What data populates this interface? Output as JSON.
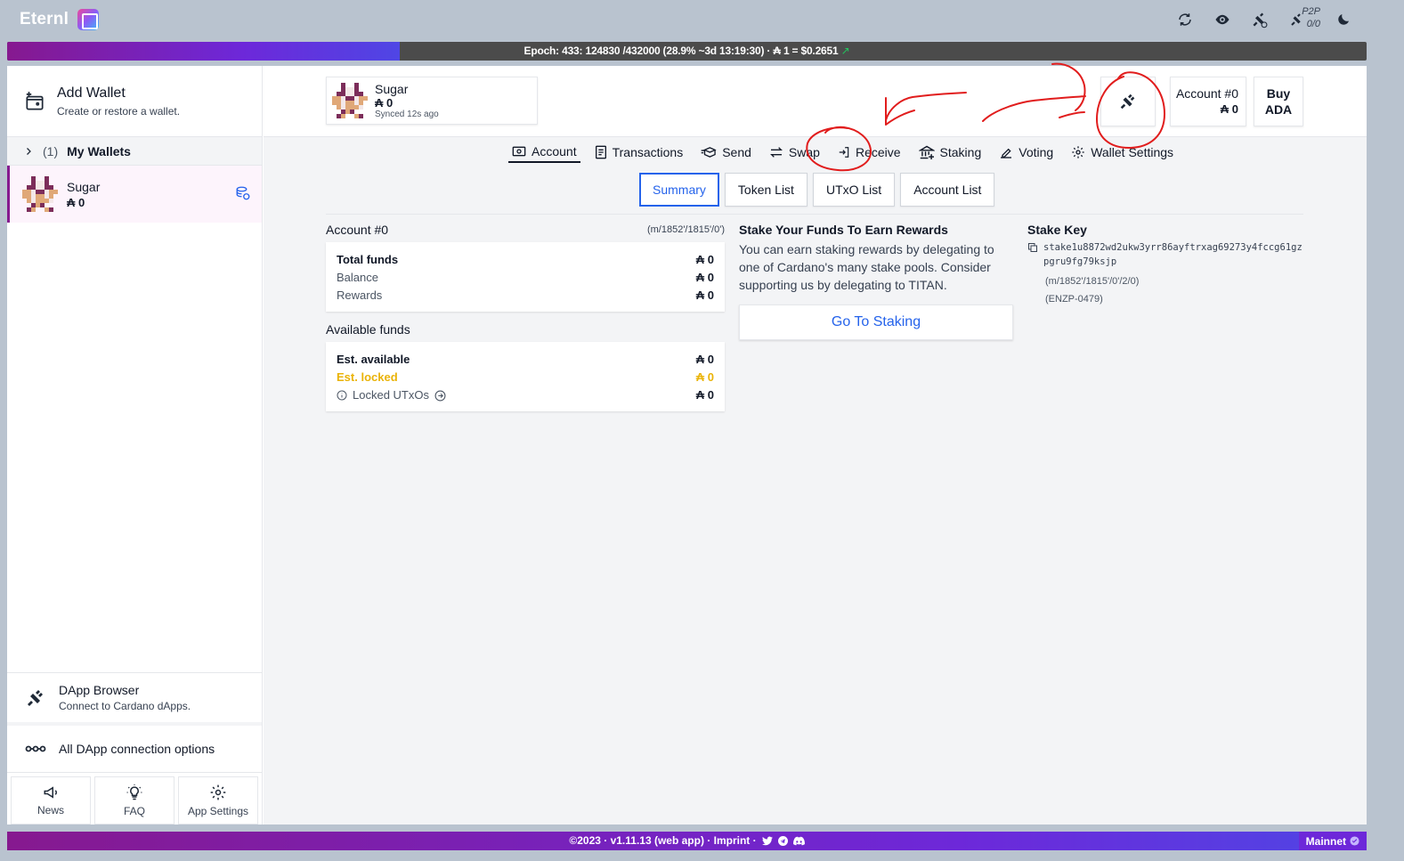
{
  "app": {
    "name": "Eternl"
  },
  "topbar": {
    "p2p_label": "P2P",
    "p2p_count": "0/0"
  },
  "epoch": {
    "text": "Epoch: 433: 124830 /432000 (28.9% ~3d 13:19:30) · ₳ 1 = $0.2651",
    "trend": "↗",
    "progress": 0.289
  },
  "sidebar": {
    "add_wallet": {
      "title": "Add Wallet",
      "subtitle": "Create or restore a wallet."
    },
    "my_wallets": {
      "count": "(1)",
      "label": "My Wallets"
    },
    "wallet": {
      "name": "Sugar",
      "balance": "₳ 0"
    },
    "dapp_browser": {
      "title": "DApp Browser",
      "subtitle": "Connect to Cardano dApps."
    },
    "all_dapp": "All DApp connection options",
    "buttons": {
      "news": "News",
      "faq": "FAQ",
      "settings": "App Settings"
    }
  },
  "header": {
    "wallet": {
      "name": "Sugar",
      "balance": "₳ 0",
      "sync": "Synced 12s ago"
    },
    "account": {
      "label": "Account #0",
      "balance": "₳ 0"
    },
    "buy": {
      "line1": "Buy",
      "line2": "ADA"
    }
  },
  "tabs": [
    "Account",
    "Transactions",
    "Send",
    "Swap",
    "Receive",
    "Staking",
    "Voting",
    "Wallet Settings"
  ],
  "subtabs": [
    "Summary",
    "Token List",
    "UTxO List",
    "Account List"
  ],
  "account": {
    "title": "Account #0",
    "path": "(m/1852'/1815'/0')",
    "total_funds": {
      "label": "Total funds",
      "value": "₳ 0"
    },
    "balance": {
      "label": "Balance",
      "value": "₳ 0"
    },
    "rewards": {
      "label": "Rewards",
      "value": "₳ 0"
    },
    "available_title": "Available funds",
    "est_available": {
      "label": "Est. available",
      "value": "₳ 0"
    },
    "est_locked": {
      "label": "Est. locked",
      "value": "₳ 0"
    },
    "locked_utxos": {
      "label": "Locked UTxOs",
      "value": "₳ 0"
    }
  },
  "stake_promo": {
    "title": "Stake Your Funds To Earn Rewards",
    "body": "You can earn staking rewards by delegating to one of Cardano's many stake pools. Consider supporting us by delegating to TITAN.",
    "button": "Go To Staking"
  },
  "stake_key": {
    "title": "Stake Key",
    "key": "stake1u8872wd2ukw3yrr86ayftrxag69273y4fccg61gzpgru9fg79ksjp",
    "path": "(m/1852'/1815'/0'/2/0)",
    "code": "(ENZP-0479)"
  },
  "footer": {
    "text": "©2023 · v1.11.13 (web app) · Imprint ·",
    "network": "Mainnet"
  },
  "colors": {
    "accent": "#2563eb",
    "brand": "#86198f",
    "locked": "#eab308",
    "annotation": "#e11d1d"
  }
}
